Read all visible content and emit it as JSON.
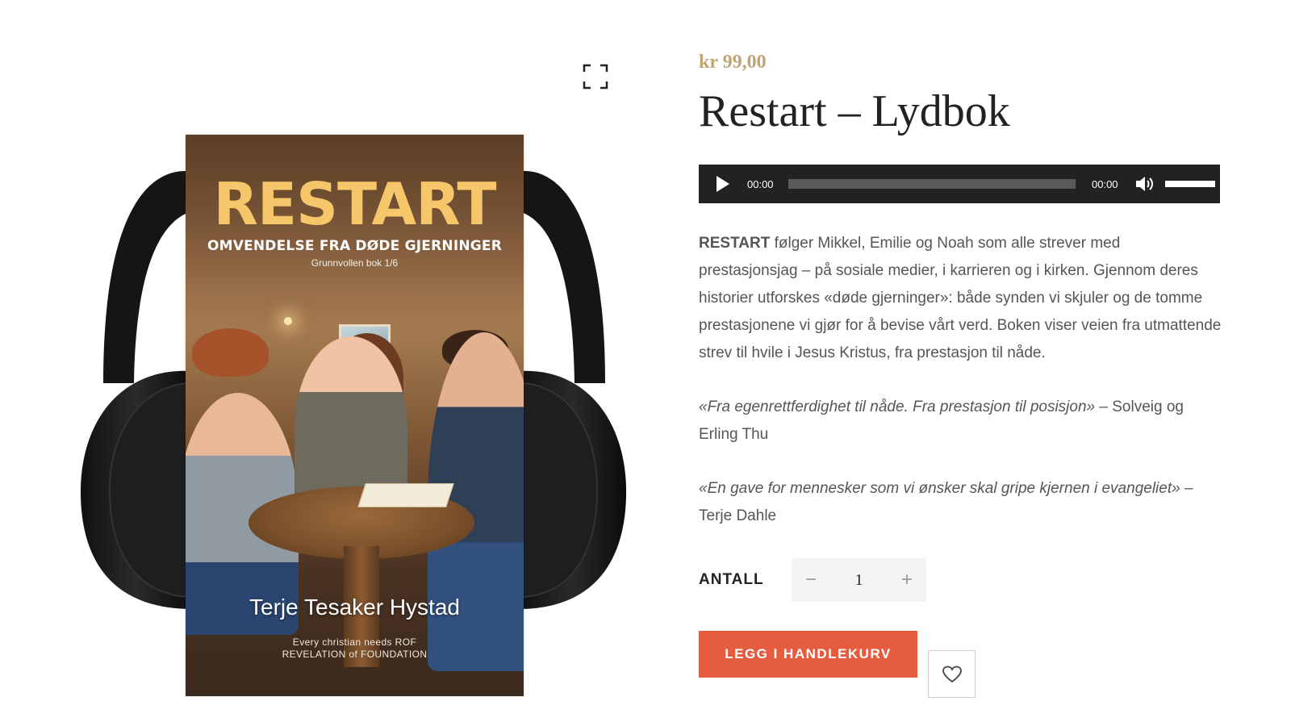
{
  "gallery": {
    "zoom_icon": "fullscreen-expand-icon",
    "cover": {
      "title": "RESTART",
      "subtitle": "OMVENDELSE FRA DØDE GJERNINGER",
      "series": "Grunnvollen bok 1/6",
      "author": "Terje Tesaker Hystad",
      "tagline_1": "Every christian needs ROF",
      "tagline_2": "REVELATION of FOUNDATION",
      "title_color": "#f6c76a"
    }
  },
  "product": {
    "price": "kr 99,00",
    "title": "Restart – Lydbok",
    "price_color": "#c1a472"
  },
  "audio": {
    "current_time": "00:00",
    "duration": "00:00",
    "progress": 0,
    "volume": 1.0,
    "play_icon": "play-icon",
    "volume_icon": "speaker-icon"
  },
  "description": {
    "p1_bold": "RESTART",
    "p1_text": " følger Mikkel, Emilie og Noah som alle strever med prestasjonsjag – på sosiale medier, i karrieren og i kirken. Gjennom deres historier utforskes «døde gjerninger»: både synden vi skjuler og de tomme prestasjonene vi gjør for å bevise vårt verd. Boken viser veien fra utmattende strev til hvile i Jesus Kristus, fra prestasjon til nåde.",
    "quote1_italic": "«Fra egenrettferdighet til nåde. Fra prestasjon til posisjon»",
    "quote1_attribution": " – Solveig og Erling Thu",
    "quote2_italic": "«En gave for mennesker som vi ønsker skal gripe kjernen i evangeliet»",
    "quote2_attribution": " – Terje Dahle"
  },
  "quantity": {
    "label": "ANTALL",
    "value": "1",
    "minus": "−",
    "plus": "+"
  },
  "actions": {
    "add_to_cart": "LEGG I HANDLEKURV",
    "cart_color": "#e65c3e",
    "wishlist_icon": "heart-icon"
  }
}
